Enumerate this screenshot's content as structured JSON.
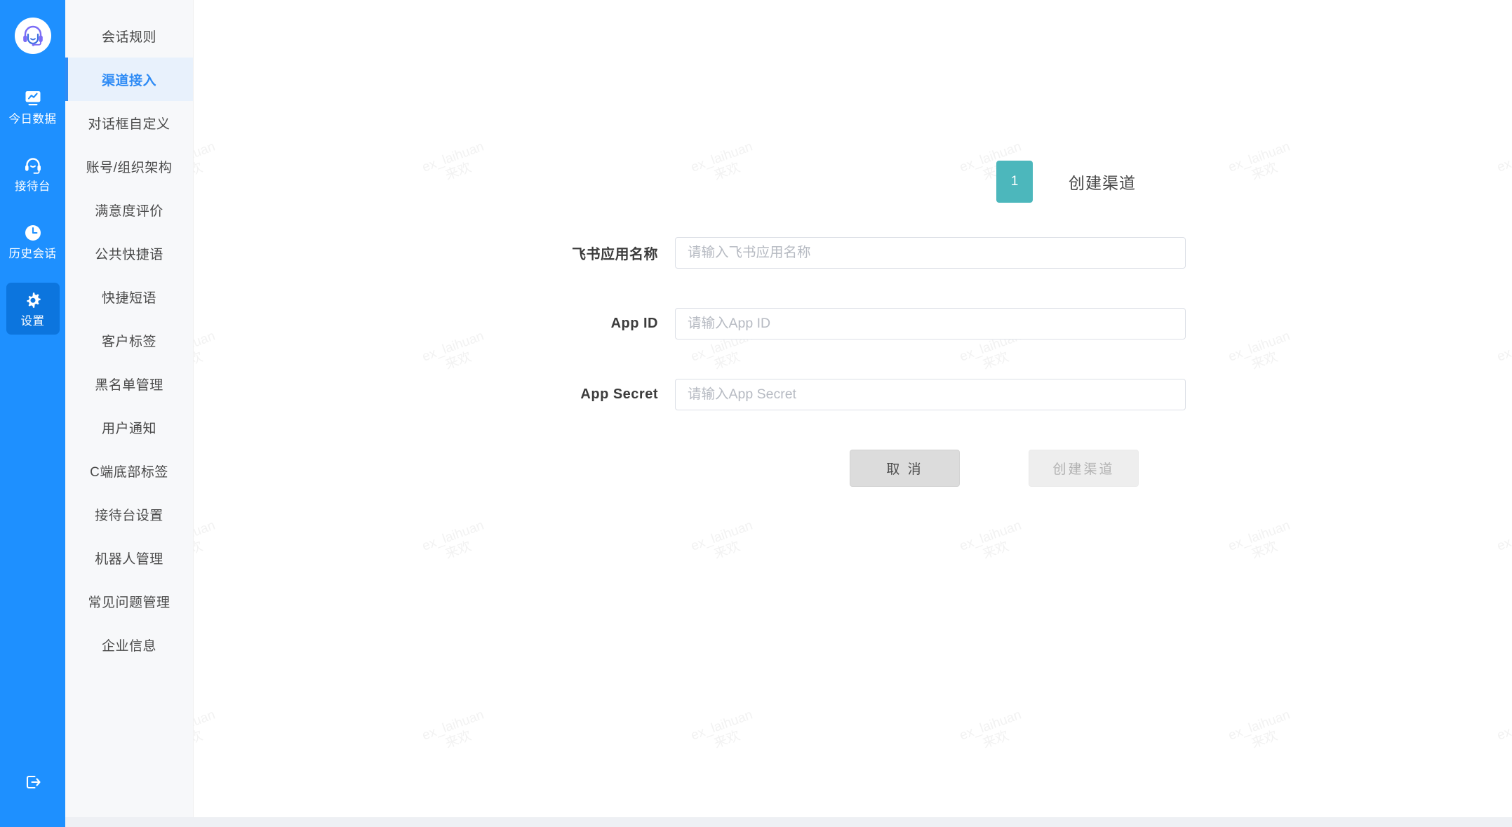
{
  "theme": {
    "rail_bg": "#1E90FF",
    "rail_active_bg": "#0C75DE",
    "subnav_bg": "#F7F8FA",
    "subnav_active_bg": "#E8F1FC",
    "accent_blue": "#2E8BF5",
    "step_teal": "#4CB7BC",
    "watermark_color": "#F2F2F2"
  },
  "rail": {
    "logo_icon": "headset-avatar-icon",
    "items": [
      {
        "label": "今日数据",
        "icon": "monitor-chart-icon",
        "active": false
      },
      {
        "label": "接待台",
        "icon": "headset-icon",
        "active": false
      },
      {
        "label": "历史会话",
        "icon": "clock-icon",
        "active": false
      },
      {
        "label": "设置",
        "icon": "gear-icon",
        "active": true
      }
    ],
    "logout_icon": "logout-icon"
  },
  "subnav": {
    "items": [
      {
        "label": "会话规则",
        "active": false
      },
      {
        "label": "渠道接入",
        "active": true
      },
      {
        "label": "对话框自定义",
        "active": false
      },
      {
        "label": "账号/组织架构",
        "active": false
      },
      {
        "label": "满意度评价",
        "active": false
      },
      {
        "label": "公共快捷语",
        "active": false
      },
      {
        "label": "快捷短语",
        "active": false
      },
      {
        "label": "客户标签",
        "active": false
      },
      {
        "label": "黑名单管理",
        "active": false
      },
      {
        "label": "用户通知",
        "active": false
      },
      {
        "label": "C端底部标签",
        "active": false
      },
      {
        "label": "接待台设置",
        "active": false
      },
      {
        "label": "机器人管理",
        "active": false
      },
      {
        "label": "常见问题管理",
        "active": false
      },
      {
        "label": "企业信息",
        "active": false
      }
    ]
  },
  "main": {
    "step": {
      "number": "1",
      "label": "创建渠道"
    },
    "form": {
      "fields": [
        {
          "label": "飞书应用名称",
          "value": "",
          "placeholder": "请输入飞书应用名称",
          "name": "feishu-app-name"
        },
        {
          "label": "App ID",
          "value": "",
          "placeholder": "请输入App ID",
          "name": "app-id"
        },
        {
          "label": "App Secret",
          "value": "",
          "placeholder": "请输入App Secret",
          "name": "app-secret"
        }
      ]
    },
    "buttons": {
      "cancel": "取 消",
      "submit": "创建渠道"
    }
  },
  "watermark": {
    "line1": "ex_laihuan",
    "line2": "来欢"
  }
}
